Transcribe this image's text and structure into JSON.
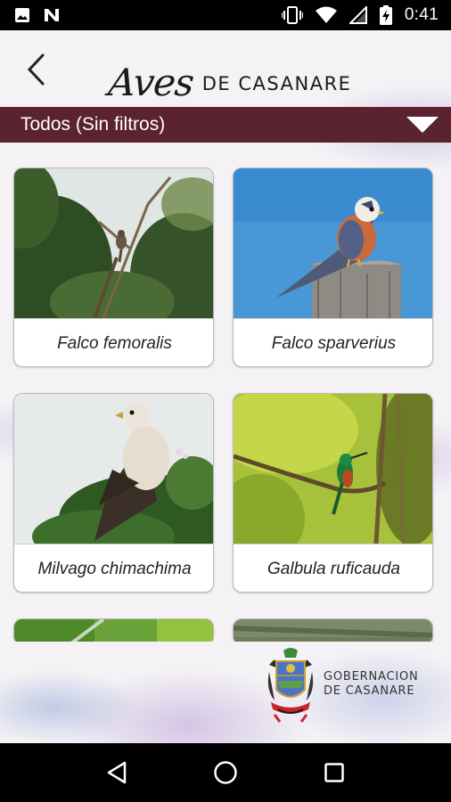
{
  "status_bar": {
    "time": "0:41",
    "icons": [
      "image-icon",
      "n-notification-icon",
      "vibrate-icon",
      "wifi-icon",
      "signal-icon",
      "battery-charging-icon"
    ]
  },
  "header": {
    "title_script": "Aves",
    "title_rest": "DE CASANARE",
    "back_icon": "chevron-left-icon"
  },
  "filter": {
    "label": "Todos (Sin filtros)",
    "dropdown_icon": "triangle-down-icon",
    "bar_color": "#5b2230"
  },
  "birds": [
    {
      "name": "Falco femoralis"
    },
    {
      "name": "Falco sparverius"
    },
    {
      "name": "Milvago chimachima"
    },
    {
      "name": "Galbula ruficauda"
    }
  ],
  "footer": {
    "org_line1": "GOBERNACION",
    "org_line2": "DE CASANARE"
  },
  "nav": {
    "back": "triangle-back-icon",
    "home": "circle-home-icon",
    "recents": "square-recents-icon"
  }
}
